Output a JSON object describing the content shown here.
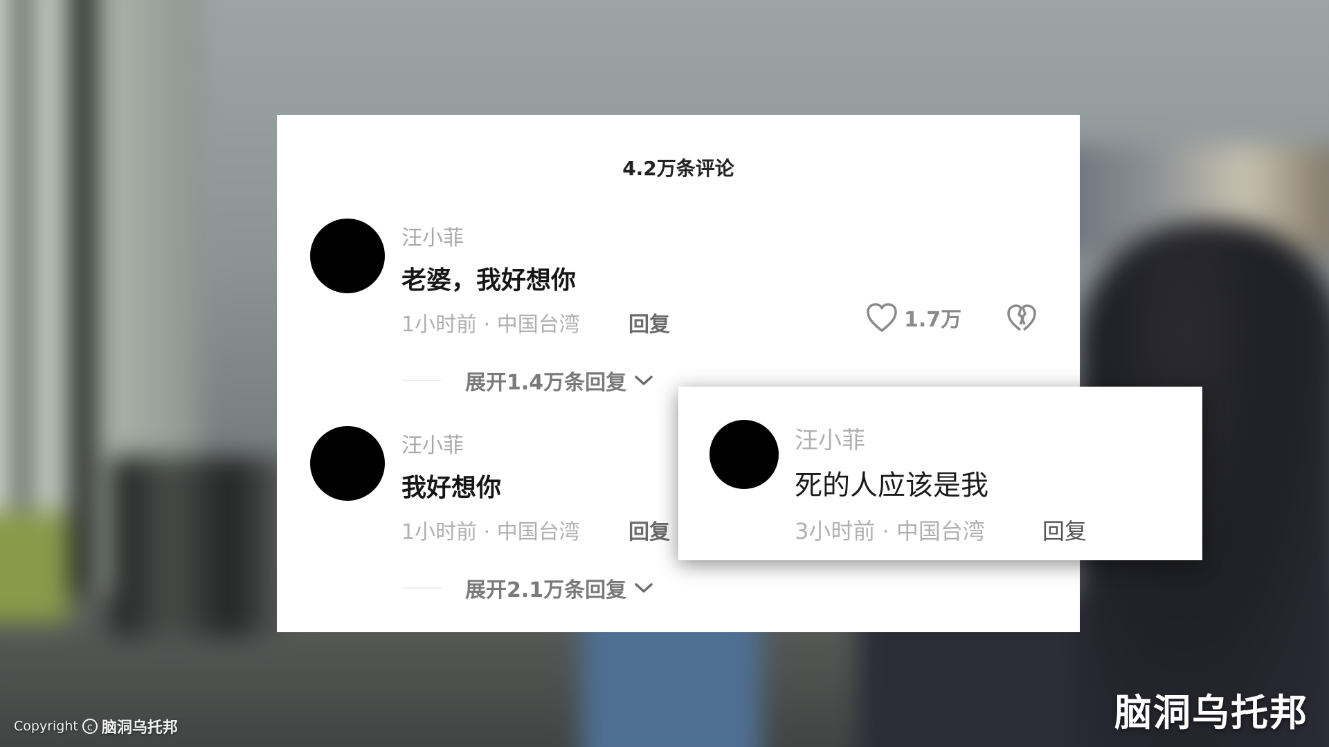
{
  "card": {
    "title": "4.2万条评论",
    "comments": [
      {
        "username": "汪小菲",
        "text": "老婆，我好想你",
        "meta": "1小时前 · 中国台湾",
        "reply_label": "回复",
        "likes": "1.7万",
        "expand_label": "展开1.4万条回复"
      },
      {
        "username": "汪小菲",
        "text": "我好想你",
        "meta": "1小时前 · 中国台湾",
        "reply_label": "回复",
        "expand_label": "展开2.1万条回复"
      }
    ]
  },
  "popout": {
    "username": "汪小菲",
    "text": "死的人应该是我",
    "meta": "3小时前 · 中国台湾",
    "reply_label": "回复"
  },
  "watermark": {
    "right": "脑洞乌托邦",
    "left_prefix": "Copyright",
    "left_brand": "脑洞乌托邦"
  },
  "icons": {
    "like": "heart-outline-icon",
    "dislike": "broken-heart-icon",
    "expand": "chevron-down-icon",
    "copyright": "copyright-icon"
  }
}
